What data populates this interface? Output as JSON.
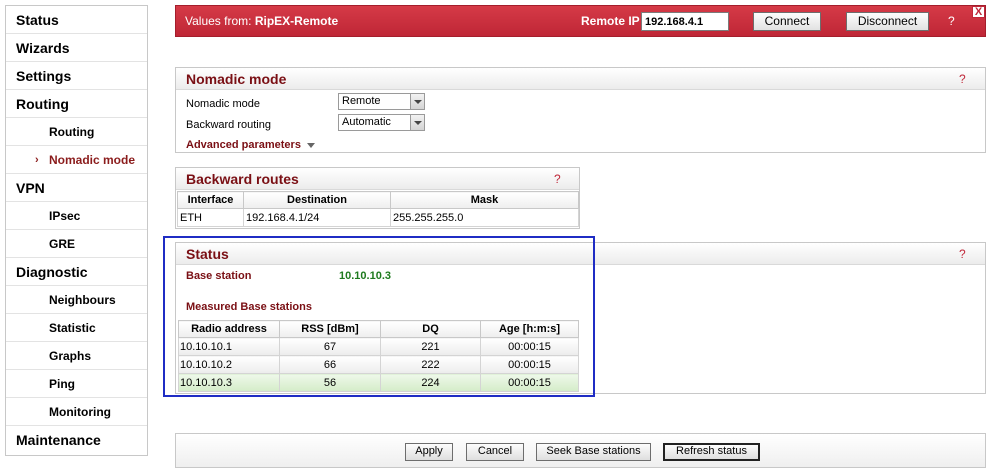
{
  "sidebar": {
    "items": [
      {
        "label": "Status",
        "level": "main"
      },
      {
        "label": "Wizards",
        "level": "main"
      },
      {
        "label": "Settings",
        "level": "main"
      },
      {
        "label": "Routing",
        "level": "main"
      },
      {
        "label": "Routing",
        "level": "sub"
      },
      {
        "label": "Nomadic mode",
        "level": "sub",
        "active": true,
        "marker": "›"
      },
      {
        "label": "VPN",
        "level": "main"
      },
      {
        "label": "IPsec",
        "level": "sub"
      },
      {
        "label": "GRE",
        "level": "sub"
      },
      {
        "label": "Diagnostic",
        "level": "main"
      },
      {
        "label": "Neighbours",
        "level": "sub"
      },
      {
        "label": "Statistic",
        "level": "sub"
      },
      {
        "label": "Graphs",
        "level": "sub"
      },
      {
        "label": "Ping",
        "level": "sub"
      },
      {
        "label": "Monitoring",
        "level": "sub"
      },
      {
        "label": "Maintenance",
        "level": "main"
      }
    ]
  },
  "header": {
    "values_from_prefix": "Values from: ",
    "values_from_name": "RipEX-Remote",
    "remote_ip_label": "Remote IP",
    "remote_ip_value": "192.168.4.1",
    "connect_label": "Connect",
    "disconnect_label": "Disconnect",
    "help": "?",
    "close": "X"
  },
  "nomadic": {
    "title": "Nomadic mode",
    "help": "?",
    "mode_label": "Nomadic mode",
    "mode_value": "Remote",
    "backward_label": "Backward routing",
    "backward_value": "Automatic",
    "advanced_label": "Advanced parameters"
  },
  "routes": {
    "title": "Backward routes",
    "help": "?",
    "columns": [
      "Interface",
      "Destination",
      "Mask"
    ],
    "rows": [
      [
        "ETH",
        "192.168.4.1/24",
        "255.255.255.0"
      ]
    ]
  },
  "status": {
    "title": "Status",
    "help": "?",
    "base_station_label": "Base station",
    "base_station_value": "10.10.10.3",
    "measured_title": "Measured Base stations",
    "columns": [
      "Radio address",
      "RSS [dBm]",
      "DQ",
      "Age [h:m:s]"
    ],
    "rows": [
      [
        "10.10.10.1",
        "67",
        "221",
        "00:00:15"
      ],
      [
        "10.10.10.2",
        "66",
        "222",
        "00:00:15"
      ],
      [
        "10.10.10.3",
        "56",
        "224",
        "00:00:15"
      ]
    ],
    "highlight_row": 2
  },
  "actions": {
    "apply": "Apply",
    "cancel": "Cancel",
    "seek": "Seek Base stations",
    "refresh": "Refresh status"
  },
  "colors": {
    "header_red": "#c8303f",
    "title_maroon": "#7a0f14",
    "status_green": "#1e7a1e",
    "highlight_blue": "#1f2cc4"
  }
}
